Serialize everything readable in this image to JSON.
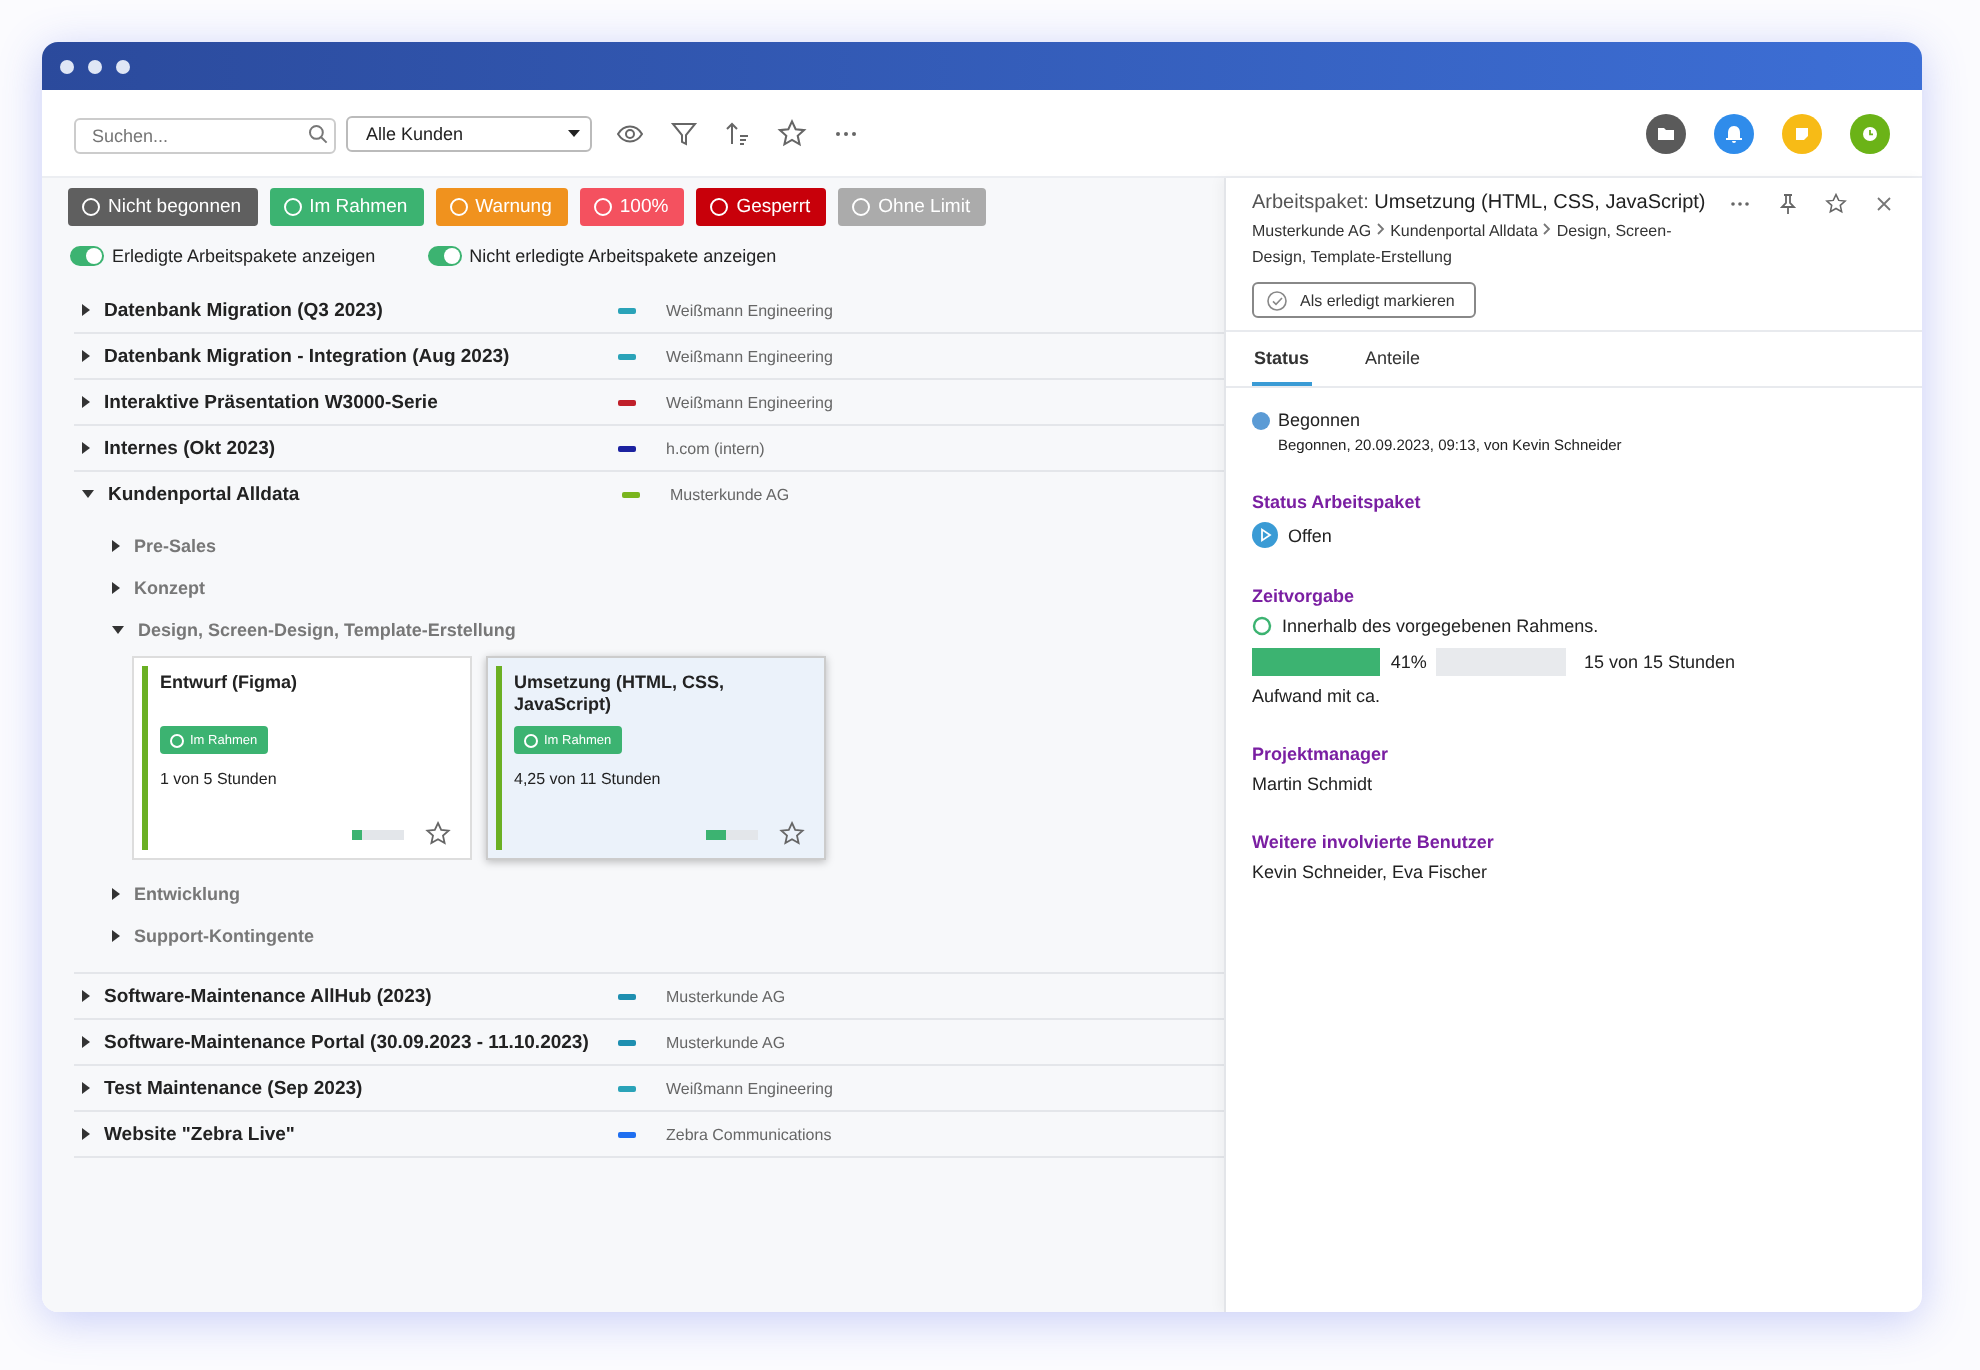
{
  "toolbar": {
    "search": {
      "placeholder": "Suchen..."
    },
    "customer_select": {
      "value": "Alle Kunden"
    },
    "apps": [
      {
        "kind": "folder",
        "color": "#5a5a5a"
      },
      {
        "kind": "bell",
        "color": "#2f8ceb"
      },
      {
        "kind": "note",
        "color": "#f7bb16"
      },
      {
        "kind": "clock",
        "color": "#6bb317"
      }
    ]
  },
  "filters": [
    {
      "label": "Nicht begonnen",
      "color": "#5f5f5f"
    },
    {
      "label": "Im Rahmen",
      "color": "#3cb371"
    },
    {
      "label": "Warnung",
      "color": "#f0921e"
    },
    {
      "label": "100%",
      "color": "#f4515f"
    },
    {
      "label": "Gesperrt",
      "color": "#c8000a"
    },
    {
      "label": "Ohne Limit",
      "color": "#ababab"
    }
  ],
  "toggles": [
    {
      "label": "Erledigte Arbeitspakete anzeigen",
      "on": true
    },
    {
      "label": "Nicht erledigte Arbeitspakete anzeigen",
      "on": true
    }
  ],
  "projects": [
    {
      "name": "Datenbank Migration (Q3 2023)",
      "expanded": false,
      "color": "#2aa3b8",
      "customer": "Weißmann Engineering"
    },
    {
      "name": "Datenbank Migration - Integration (Aug 2023)",
      "expanded": false,
      "color": "#2aa3b8",
      "customer": "Weißmann Engineering"
    },
    {
      "name": "Interaktive Präsentation W3000-Serie",
      "expanded": false,
      "color": "#c0202a",
      "customer": "Weißmann Engineering"
    },
    {
      "name": "Internes (Okt 2023)",
      "expanded": false,
      "color": "#1c22a0",
      "customer": "h.com (intern)"
    },
    {
      "name": "Kundenportal Alldata",
      "expanded": true,
      "color": "#7ab51d",
      "customer": "Musterkunde AG",
      "children": [
        {
          "name": "Pre-Sales",
          "expanded": false
        },
        {
          "name": "Konzept",
          "expanded": false
        },
        {
          "name": "Design, Screen-Design, Template-Erstellung",
          "expanded": true,
          "packages": [
            {
              "title": "Entwurf (Figma)",
              "badge": "Im Rahmen",
              "hours": "1 von 5 Stunden",
              "level": 0.2,
              "selected": false
            },
            {
              "title": "Umsetzung (HTML, CSS, JavaScript)",
              "badge": "Im Rahmen",
              "hours": "4,25 von 11 Stunden",
              "level": 0.39,
              "selected": true
            }
          ]
        },
        {
          "name": "Entwicklung",
          "expanded": false
        },
        {
          "name": "Support-Kontingente",
          "expanded": false
        }
      ]
    },
    {
      "name": "Software-Maintenance AllHub (2023)",
      "expanded": false,
      "color": "#1e8fb0",
      "customer": "Musterkunde AG"
    },
    {
      "name": "Software-Maintenance Portal (30.09.2023 - 11.10.2023)",
      "expanded": false,
      "color": "#1e8fb0",
      "customer": "Musterkunde AG"
    },
    {
      "name": "Test Maintenance (Sep 2023)",
      "expanded": false,
      "color": "#2aa3b8",
      "customer": "Weißmann Engineering"
    },
    {
      "name": "Website \"Zebra Live\"",
      "expanded": false,
      "color": "#1f6ff0",
      "customer": "Zebra Communications"
    }
  ],
  "detail": {
    "title_label": "Arbeitspaket:",
    "title": "Umsetzung (HTML, CSS, JavaScript)",
    "breadcrumb": [
      "Musterkunde AG",
      "Kundenportal Alldata",
      "Design, Screen-Design, Template-Erstellung"
    ],
    "mark_done_button": "Als erledigt markieren",
    "tabs": [
      {
        "label": "Status",
        "selected": true
      },
      {
        "label": "Anteile",
        "selected": false
      }
    ],
    "state": {
      "label": "Begonnen",
      "detail": "Begonnen, 20.09.2023, 09:13, von Kevin Schneider",
      "color": "#5b9bd5"
    },
    "work_status": {
      "heading": "Status Arbeitspaket",
      "value": "Offen"
    },
    "time": {
      "heading": "Zeitvorgabe",
      "note": "Innerhalb des vorgegebenen Rahmens.",
      "level": 0.41,
      "percent": "41%",
      "hours": "15 von 15 Stunden",
      "effort": "Aufwand mit ca."
    },
    "manager": {
      "heading": "Projektmanager",
      "value": "Martin Schmidt"
    },
    "users": {
      "heading": "Weitere involvierte Benutzer",
      "value": "Kevin Schneider, Eva Fischer"
    }
  }
}
